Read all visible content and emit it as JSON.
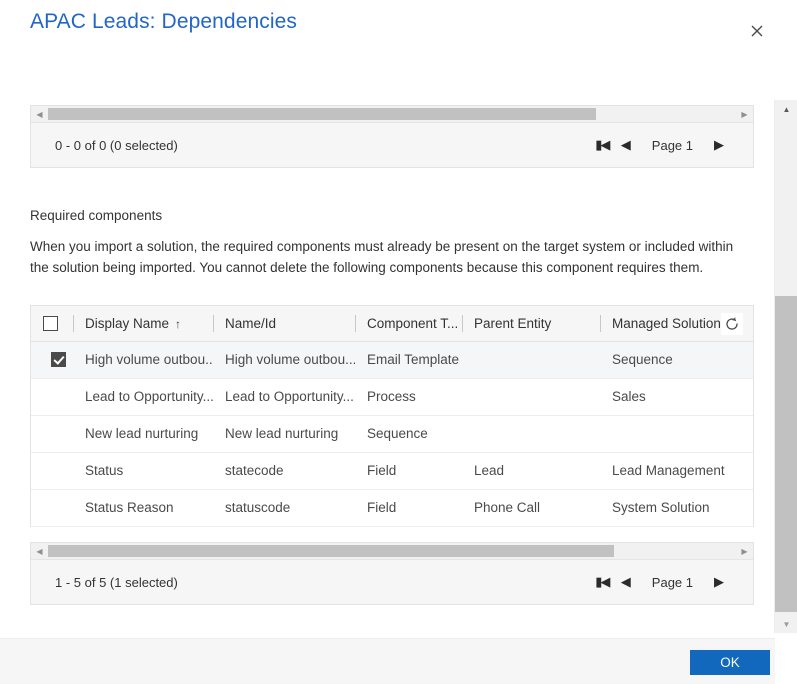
{
  "dialog": {
    "title": "APAC Leads: Dependencies",
    "close_icon": "close-icon",
    "ok_label": "OK"
  },
  "top_grid": {
    "scroll_left_icon": "triangle-left-icon",
    "scroll_right_icon": "triangle-right-icon",
    "count_label": "0 - 0 of 0 (0 selected)",
    "pager": {
      "first_icon": "page-first-icon",
      "prev_icon": "page-prev-icon",
      "page_label": "Page 1",
      "next_icon": "page-next-icon"
    }
  },
  "required_components": {
    "heading": "Required components",
    "description": "When you import a solution, the required components must already be present on the target system or included within the solution being imported. You cannot delete the following components because this component requires them."
  },
  "table": {
    "select_all_checked": false,
    "refresh_icon": "refresh-spinner-icon",
    "columns": [
      {
        "label": "Display Name",
        "sort": "↑"
      },
      {
        "label": "Name/Id",
        "sort": ""
      },
      {
        "label": "Component T...",
        "sort": ""
      },
      {
        "label": "Parent Entity",
        "sort": ""
      },
      {
        "label": "Managed Solution",
        "sort": ""
      }
    ],
    "rows": [
      {
        "selected": true,
        "display_name": "High volume outbou...",
        "name_id": "High volume outbou...",
        "component_type": "Email Template",
        "parent_entity": "",
        "managed_solution": "Sequence"
      },
      {
        "selected": false,
        "display_name": "Lead to Opportunity...",
        "name_id": "Lead to Opportunity...",
        "component_type": "Process",
        "parent_entity": "",
        "managed_solution": "Sales"
      },
      {
        "selected": false,
        "display_name": "New lead nurturing",
        "name_id": "New lead nurturing",
        "component_type": "Sequence",
        "parent_entity": "",
        "managed_solution": ""
      },
      {
        "selected": false,
        "display_name": "Status",
        "name_id": "statecode",
        "component_type": "Field",
        "parent_entity": "Lead",
        "managed_solution": "Lead Management"
      },
      {
        "selected": false,
        "display_name": "Status Reason",
        "name_id": "statuscode",
        "component_type": "Field",
        "parent_entity": "Phone Call",
        "managed_solution": "System Solution"
      }
    ]
  },
  "bottom_grid": {
    "scroll_left_icon": "triangle-left-icon",
    "scroll_right_icon": "triangle-right-icon",
    "count_label": "1 - 5 of 5 (1 selected)",
    "pager": {
      "first_icon": "page-first-icon",
      "prev_icon": "page-prev-icon",
      "page_label": "Page 1",
      "next_icon": "page-next-icon"
    }
  },
  "vertical_scrollbar": {
    "up_icon": "triangle-up-icon",
    "down_icon": "triangle-down-icon"
  },
  "colors": {
    "title_blue": "#2266c8",
    "ok_blue": "#1268bd",
    "row_selected_bg": "#f4f6f8"
  }
}
